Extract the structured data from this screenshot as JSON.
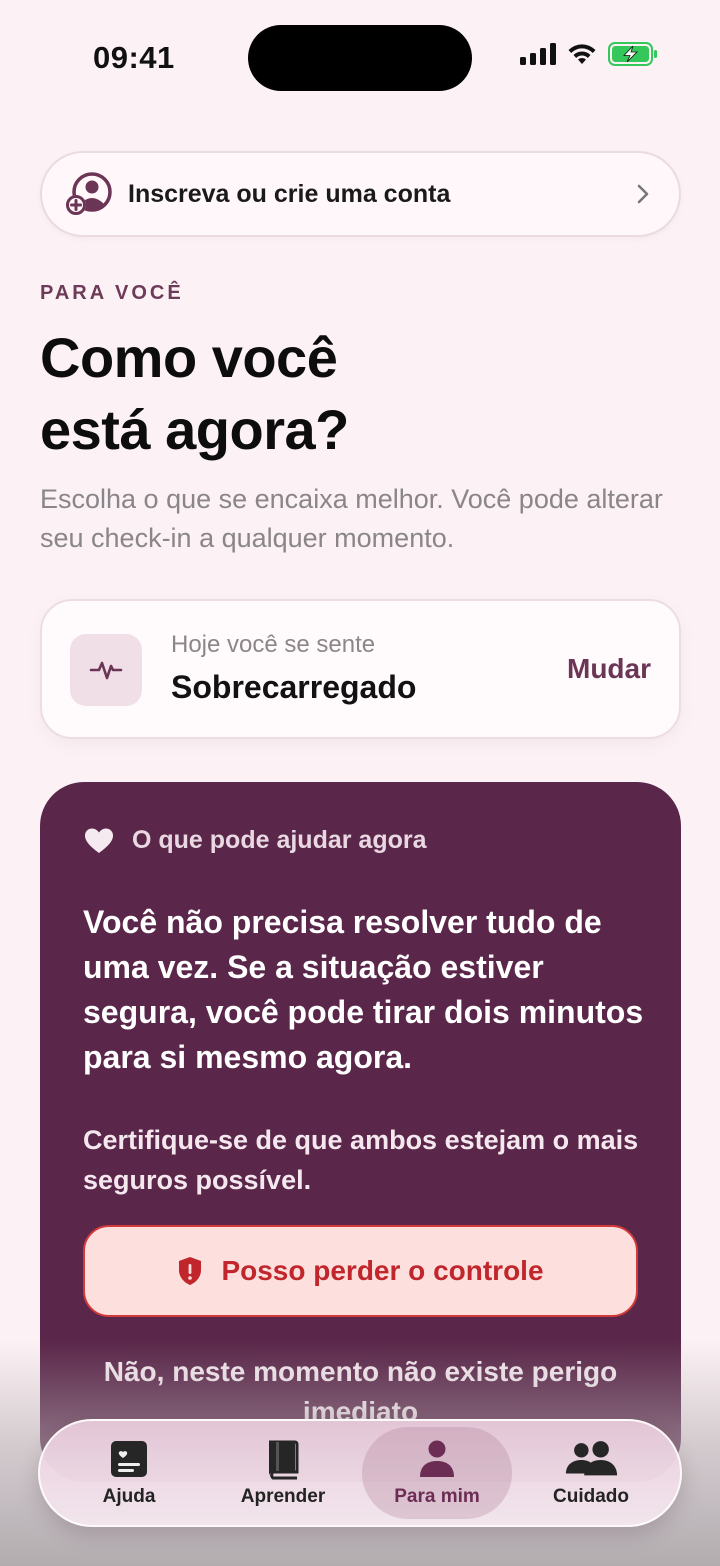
{
  "status_bar": {
    "time": "09:41"
  },
  "signin": {
    "label": "Inscreva ou crie uma conta"
  },
  "header": {
    "eyebrow": "PARA VOCÊ",
    "title_line1": "Como você",
    "title_line2": "está agora?",
    "subtitle": "Escolha o que se encaixa melhor. Você pode alterar seu check-in a qualquer momento."
  },
  "mood": {
    "caption": "Hoje você se sente",
    "value": "Sobrecarregado",
    "change_label": "Mudar"
  },
  "help": {
    "heading": "O que pode ajudar agora",
    "main_text": "Você não precisa resolver tudo de uma vez. Se a situação estiver segura, você pode tirar dois minutos para si mesmo agora.",
    "secondary_text": "Certifique-se de que ambos estejam o mais seguros possível.",
    "danger_button": "Posso perder o controle",
    "safe_text": "Não, neste momento não existe perigo imediato"
  },
  "tabs": [
    {
      "label": "Ajuda",
      "icon": "help-card-icon",
      "active": false
    },
    {
      "label": "Aprender",
      "icon": "book-icon",
      "active": false
    },
    {
      "label": "Para mim",
      "icon": "person-icon",
      "active": true
    },
    {
      "label": "Cuidado",
      "icon": "people-icon",
      "active": false
    }
  ],
  "colors": {
    "background": "#fcf2f6",
    "accent": "#6b3555",
    "card_dark": "#5a2649",
    "danger": "#c0262b",
    "danger_bg": "#fde0de",
    "battery": "#34c759"
  }
}
